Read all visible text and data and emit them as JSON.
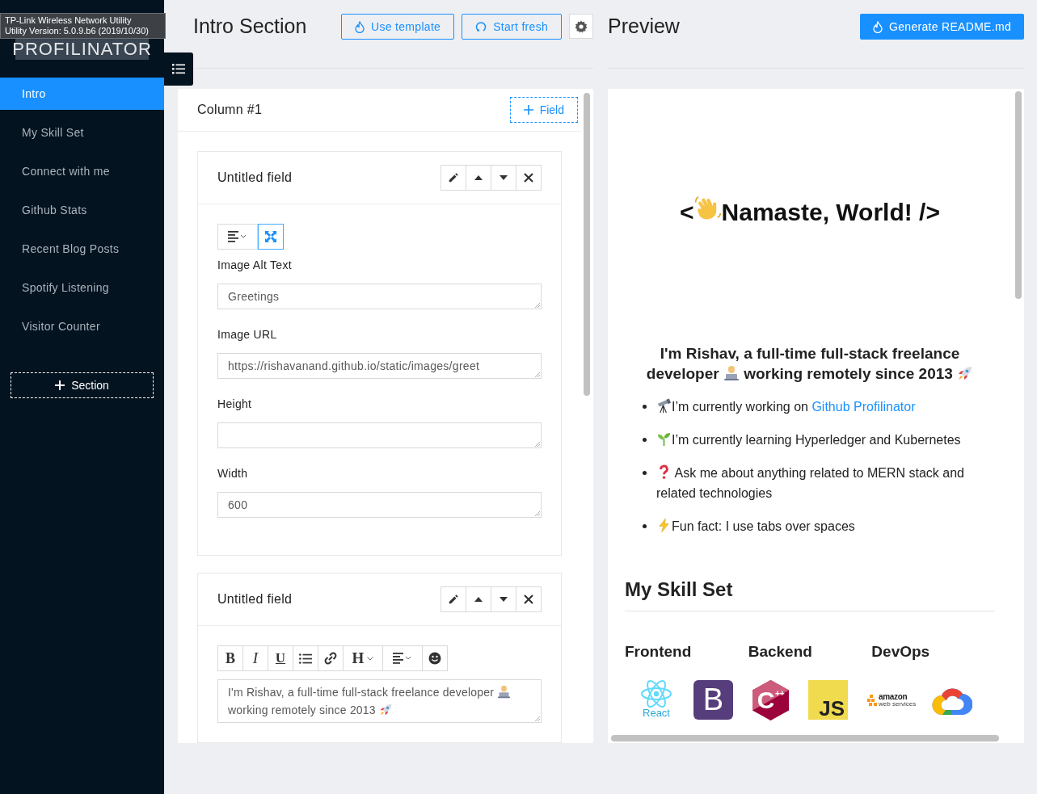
{
  "tooltip": {
    "lines": [
      "TP-Link Wireless Network Utility",
      "Utility Version: 5.0.9.b6 (2019/10/30)"
    ]
  },
  "sidebar": {
    "logo": "PROFILINATOR",
    "items": [
      {
        "label": "Intro",
        "selected": true
      },
      {
        "label": "My Skill Set",
        "selected": false
      },
      {
        "label": "Connect with me",
        "selected": false
      },
      {
        "label": "Github Stats",
        "selected": false
      },
      {
        "label": "Recent Blog Posts",
        "selected": false
      },
      {
        "label": "Spotify Listening",
        "selected": false
      },
      {
        "label": "Visitor Counter",
        "selected": false
      }
    ],
    "add_button": "Section"
  },
  "editor": {
    "title": "Intro Section",
    "buttons": [
      {
        "kind": "template",
        "label": "Use template"
      },
      {
        "kind": "fresh",
        "label": "Start fresh"
      }
    ],
    "column": {
      "title": "Column #1",
      "add_button": "Field"
    },
    "fields": [
      {
        "kind": "image",
        "title": "Untitled field",
        "full_width": true,
        "inputs": [
          {
            "label": "Image Alt Text",
            "value": "Greetings"
          },
          {
            "label": "Image URL",
            "value": "https://rishavanand.github.io/static/images/greet"
          },
          {
            "label": "Height"
          },
          {
            "label": "Width",
            "value": "600"
          }
        ]
      },
      {
        "kind": "text",
        "title": "Untitled field",
        "toolbar": [
          {
            "kind": "bold",
            "label": "B"
          },
          {
            "kind": "italic",
            "label": "I"
          },
          {
            "kind": "underline",
            "label": "U"
          },
          {
            "kind": "list"
          },
          {
            "kind": "link"
          },
          {
            "kind": "heading",
            "label": "H"
          },
          {
            "kind": "align"
          },
          {
            "kind": "emoji"
          }
        ],
        "value": [
          {
            "kind": "text",
            "text": "I'm Rishav, a full-time full-stack freelance developer "
          },
          {
            "kind": "coder"
          },
          {
            "kind": "text",
            "text": "working remotely since 2013 "
          },
          {
            "kind": "rocket"
          }
        ]
      }
    ]
  },
  "preview": {
    "title": "Preview",
    "generate_button": "Generate README.md",
    "heading": [
      {
        "kind": "text",
        "text": "<"
      },
      {
        "kind": "wave"
      },
      {
        "kind": "text",
        "text": "Namaste, World! />"
      }
    ],
    "intro": [
      {
        "kind": "text",
        "text": "I'm Rishav, a full-time full-stack freelance developer "
      },
      {
        "kind": "coder"
      },
      {
        "kind": "text",
        "text": " working remotely since 2013 "
      },
      {
        "kind": "rocket"
      }
    ],
    "bullets": [
      [
        {
          "kind": "telescope"
        },
        {
          "kind": "text",
          "text": "I’m currently working on "
        },
        {
          "kind": "link",
          "text": "Github Profilinator"
        }
      ],
      [
        {
          "kind": "seedling"
        },
        {
          "kind": "text",
          "text": "I’m currently learning Hyperledger and Kubernetes"
        }
      ],
      [
        {
          "kind": "question"
        },
        {
          "kind": "text",
          "text": " Ask me about anything related to MERN stack and related technologies"
        }
      ],
      [
        {
          "kind": "bolt"
        },
        {
          "kind": "text",
          "text": "Fun fact: I use tabs over spaces"
        }
      ]
    ],
    "skills": {
      "title": "My Skill Set",
      "categories": [
        "Frontend",
        "Backend",
        "DevOps"
      ],
      "logos": [
        {
          "kind": "react",
          "label": "React"
        },
        {
          "kind": "bootstrap",
          "label": "B"
        },
        {
          "kind": "cpp",
          "label": "C",
          "suffix": "++"
        },
        {
          "kind": "js",
          "label": "JS"
        },
        {
          "kind": "aws",
          "label": "amazon",
          "suffix": "web services"
        },
        {
          "kind": "gcloud"
        }
      ]
    }
  }
}
